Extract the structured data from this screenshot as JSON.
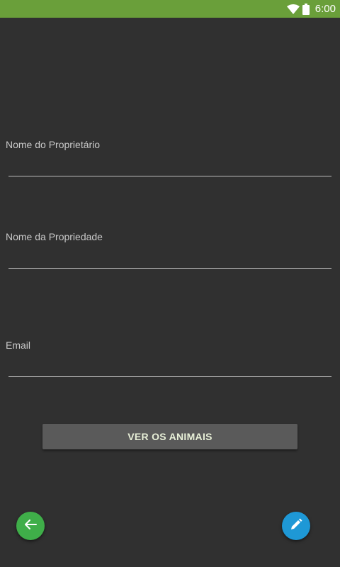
{
  "status_bar": {
    "time": "6:00",
    "color": "#6a9f3a",
    "icons": [
      "wifi-icon",
      "battery-icon"
    ]
  },
  "form": {
    "owner_label": "Nome do Proprietário",
    "owner_value": "",
    "property_label": "Nome da Propriedade",
    "property_value": "",
    "email_label": "Email",
    "email_value": ""
  },
  "actions": {
    "view_animals_label": "VER OS ANIMAIS",
    "back_icon": "arrow-left-icon",
    "back_color": "#3fae49",
    "edit_icon": "pencil-icon",
    "edit_color": "#1e98d6"
  }
}
